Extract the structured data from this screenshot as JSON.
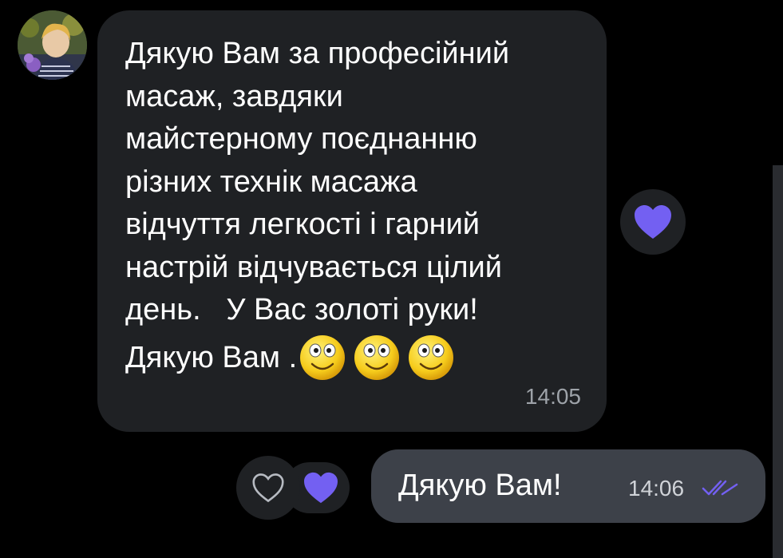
{
  "incoming_message": {
    "text": "Дякую Вам за професійний\nмасаж, завдяки\nмайстерному поєднанню\nрізних технік масажа\nвідчуття легкості і гарний\nнастрій відчувається цілий\nдень.   У Вас золоті руки!",
    "closing": "Дякую Вам .",
    "emojis": [
      "smiling-face-icon",
      "smiling-face-icon",
      "smiling-face-icon"
    ],
    "time": "14:05",
    "reaction": "purple-heart-icon"
  },
  "outgoing_message": {
    "text": "Дякую Вам!",
    "time": "14:06",
    "status": "double-check-icon",
    "reactions": [
      "heart-outline-icon",
      "purple-heart-icon"
    ]
  },
  "colors": {
    "background": "#000000",
    "incoming_bubble": "#1f2124",
    "outgoing_bubble": "#3d4149",
    "accent_heart": "#7360f2",
    "timestamp": "#9ea3a9"
  }
}
